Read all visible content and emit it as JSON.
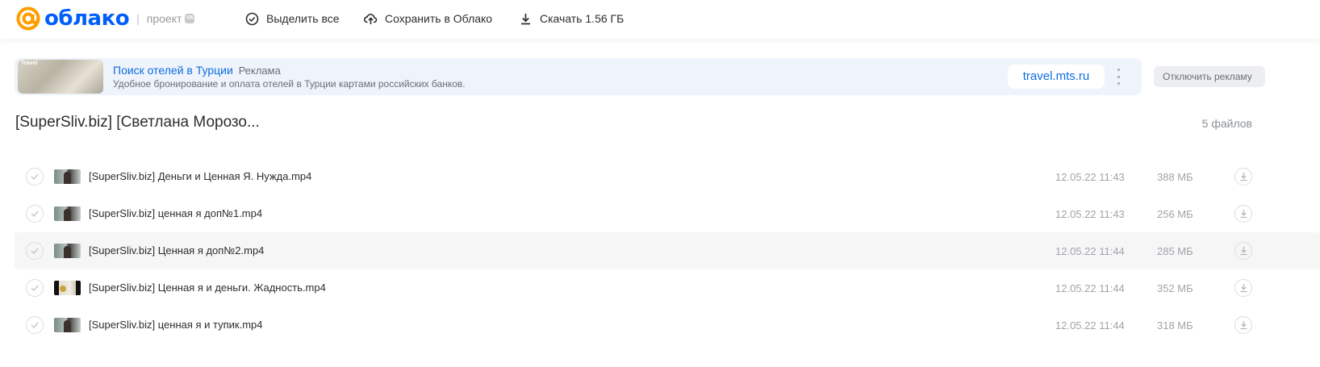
{
  "header": {
    "logo_text": "облако",
    "logo_separator": "|",
    "logo_sub": "проект",
    "vk_badge": "VK",
    "select_all": "Выделить все",
    "save_to_cloud": "Сохранить в Облако",
    "download": "Скачать 1.56 ГБ"
  },
  "ad": {
    "thumb_label": "Travel",
    "title": "Поиск отелей в Турции",
    "tag": "Реклама",
    "description": "Удобное бронирование и оплата отелей в Турции картами российских банков.",
    "site": "travel.mts.ru",
    "disable_label": "Отключить рекламу"
  },
  "folder": {
    "title": "[SuperSliv.biz] [Светлана Морозо...",
    "count": "5 файлов"
  },
  "files": [
    {
      "name": "[SuperSliv.biz] Деньги и Ценная Я. Нужда.mp4",
      "date": "12.05.22 11:43",
      "size": "388 МБ"
    },
    {
      "name": "[SuperSliv.biz] ценная я доп№1.mp4",
      "date": "12.05.22 11:43",
      "size": "256 МБ"
    },
    {
      "name": "[SuperSliv.biz] Ценная я доп№2.mp4",
      "date": "12.05.22 11:44",
      "size": "285 МБ"
    },
    {
      "name": "[SuperSliv.biz] Ценная я и деньги. Жадность.mp4",
      "date": "12.05.22 11:44",
      "size": "352 МБ"
    },
    {
      "name": "[SuperSliv.biz] ценная я и тупик.mp4",
      "date": "12.05.22 11:44",
      "size": "318 МБ"
    }
  ],
  "colors": {
    "brand_blue": "#005ff9",
    "brand_orange": "#ff9e00",
    "link_blue": "#0d6ee0",
    "ad_background": "#eef3fc",
    "muted_text": "#a0a4a9"
  },
  "icons": {
    "logo": "at-sign-icon",
    "select_all": "check-circle-icon",
    "save": "cloud-upload-icon",
    "download": "download-icon",
    "row_check": "check-icon",
    "row_download": "download-icon",
    "ad_menu": "more-vertical-icon"
  }
}
